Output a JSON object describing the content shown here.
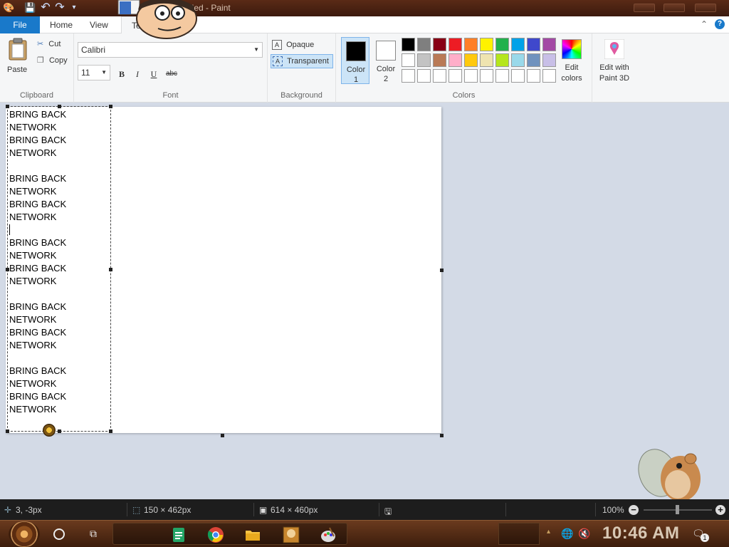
{
  "window": {
    "title": "Untitled - Paint",
    "quick_access": [
      {
        "name": "save",
        "glyph": "💾"
      },
      {
        "name": "undo",
        "glyph": "↶"
      },
      {
        "name": "redo",
        "glyph": "↷"
      },
      {
        "name": "customize",
        "glyph": "▾"
      }
    ]
  },
  "tabs": [
    {
      "label": "File",
      "active": false
    },
    {
      "label": "Home",
      "active": false
    },
    {
      "label": "View",
      "active": false
    },
    {
      "label": "Te",
      "active": true
    }
  ],
  "ribbon": {
    "clipboard": {
      "label": "Clipboard",
      "paste": "Paste",
      "cut": "Cut",
      "copy": "Copy"
    },
    "font": {
      "label": "Font",
      "family": "Calibri",
      "size": "11",
      "bold": "B",
      "italic": "I",
      "underline": "U",
      "strikethrough": "abc"
    },
    "background": {
      "label": "Background",
      "opaque": "Opaque",
      "transparent": "Transparent",
      "selected": "Transparent"
    },
    "colors": {
      "label": "Colors",
      "color1": {
        "line1": "Color",
        "line2": "1",
        "value": "#000000"
      },
      "color2": {
        "line1": "Color",
        "line2": "2",
        "value": "#ffffff"
      },
      "palette": [
        [
          "#000000",
          "#7f7f7f",
          "#880015",
          "#ed1c24",
          "#ff7f27",
          "#fff200",
          "#22b14c",
          "#00a2e8",
          "#3f48cc",
          "#a349a4"
        ],
        [
          "#ffffff",
          "#c3c3c3",
          "#b97a57",
          "#ffaec9",
          "#ffc90e",
          "#efe4b0",
          "#b5e61d",
          "#99d9ea",
          "#7092be",
          "#c8bfe7"
        ],
        [
          "#ffffff",
          "#ffffff",
          "#ffffff",
          "#ffffff",
          "#ffffff",
          "#ffffff",
          "#ffffff",
          "#ffffff",
          "#ffffff",
          "#ffffff"
        ]
      ],
      "edit_colors": [
        "Edit",
        "colors"
      ],
      "edit_with_paint3d": [
        "Edit with",
        "Paint 3D"
      ]
    }
  },
  "canvas": {
    "text_lines": [
      "BRING BACK",
      "NETWORK",
      "BRING BACK",
      "NETWORK",
      "",
      "BRING BACK",
      "NETWORK",
      "BRING BACK",
      "NETWORK",
      "",
      "BRING BACK",
      "NETWORK",
      "BRING BACK",
      "NETWORK",
      "",
      "BRING BACK",
      "NETWORK",
      "BRING BACK",
      "NETWORK",
      "",
      "BRING BACK",
      "NETWORK",
      "BRING BACK",
      "NETWORK"
    ]
  },
  "statusbar": {
    "cursor_pos": "3, -3px",
    "selection_size": "150 × 462px",
    "canvas_size": "614 × 460px",
    "zoom": "100%"
  },
  "taskbar": {
    "time": "10:46 AM",
    "notification_count": "1"
  }
}
